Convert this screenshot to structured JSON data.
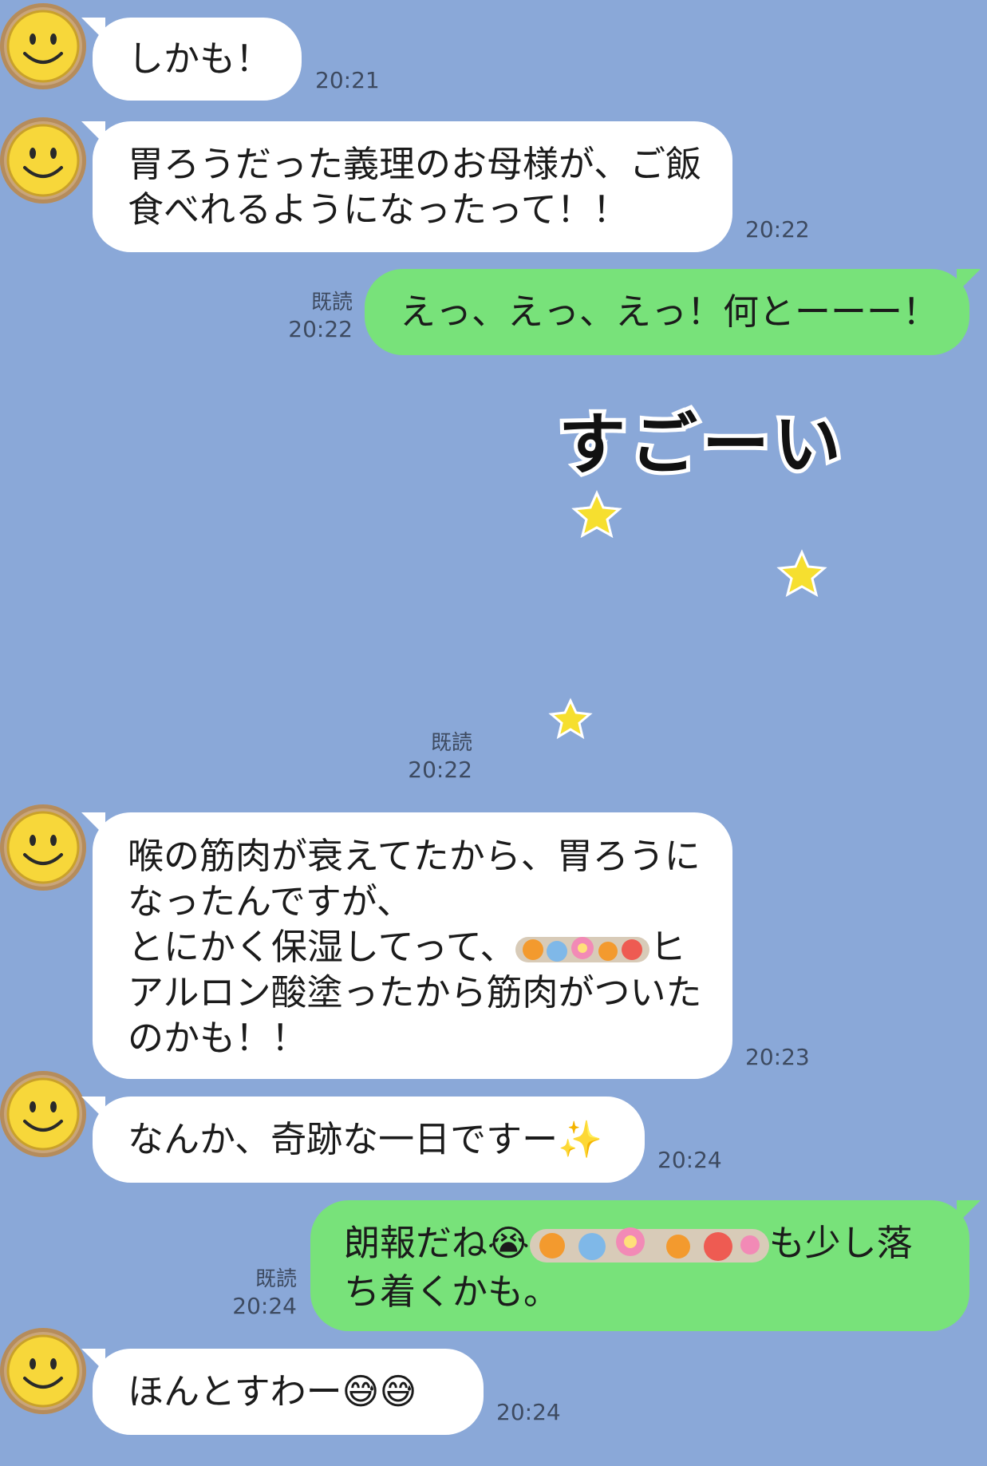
{
  "messages": [
    {
      "text": "しかも！",
      "time": "20:21"
    },
    {
      "text_line1": "胃ろうだった義理のお母様が、ご飯",
      "text_line2": "食べれるようになったって！！",
      "time": "20:22"
    },
    {
      "text": "えっ、えっ、えっ！何とーーー！",
      "read": "既読",
      "time": "20:22"
    },
    {
      "sticker_text": "すごーい",
      "read": "既読",
      "time": "20:22"
    },
    {
      "line1": "喉の筋肉が衰えてたから、胃ろうに",
      "line2": "なったんですが、",
      "line3a": "とにかく保湿してって、",
      "line3b": "ヒ",
      "line4": "アルロン酸塗ったから筋肉がついた",
      "line5": "のかも！！",
      "time": "20:23"
    },
    {
      "text": "なんか、奇跡な一日ですー",
      "emoji": "✨",
      "time": "20:24"
    },
    {
      "line1a": "朗報だね",
      "emoji": "😭",
      "line1b": "も少し落",
      "line2": "ち着くかも。",
      "read": "既読",
      "time": "20:24"
    },
    {
      "text": "ほんとすわー",
      "emoji": "😅😅",
      "time": "20:24"
    }
  ],
  "colors": {
    "background": "#8aa8d8",
    "incoming_bubble": "#ffffff",
    "outgoing_bubble": "#78e27a"
  },
  "icons": {
    "avatar": "smiley-face-icon",
    "sticker": "cat-cheering-sticker"
  }
}
